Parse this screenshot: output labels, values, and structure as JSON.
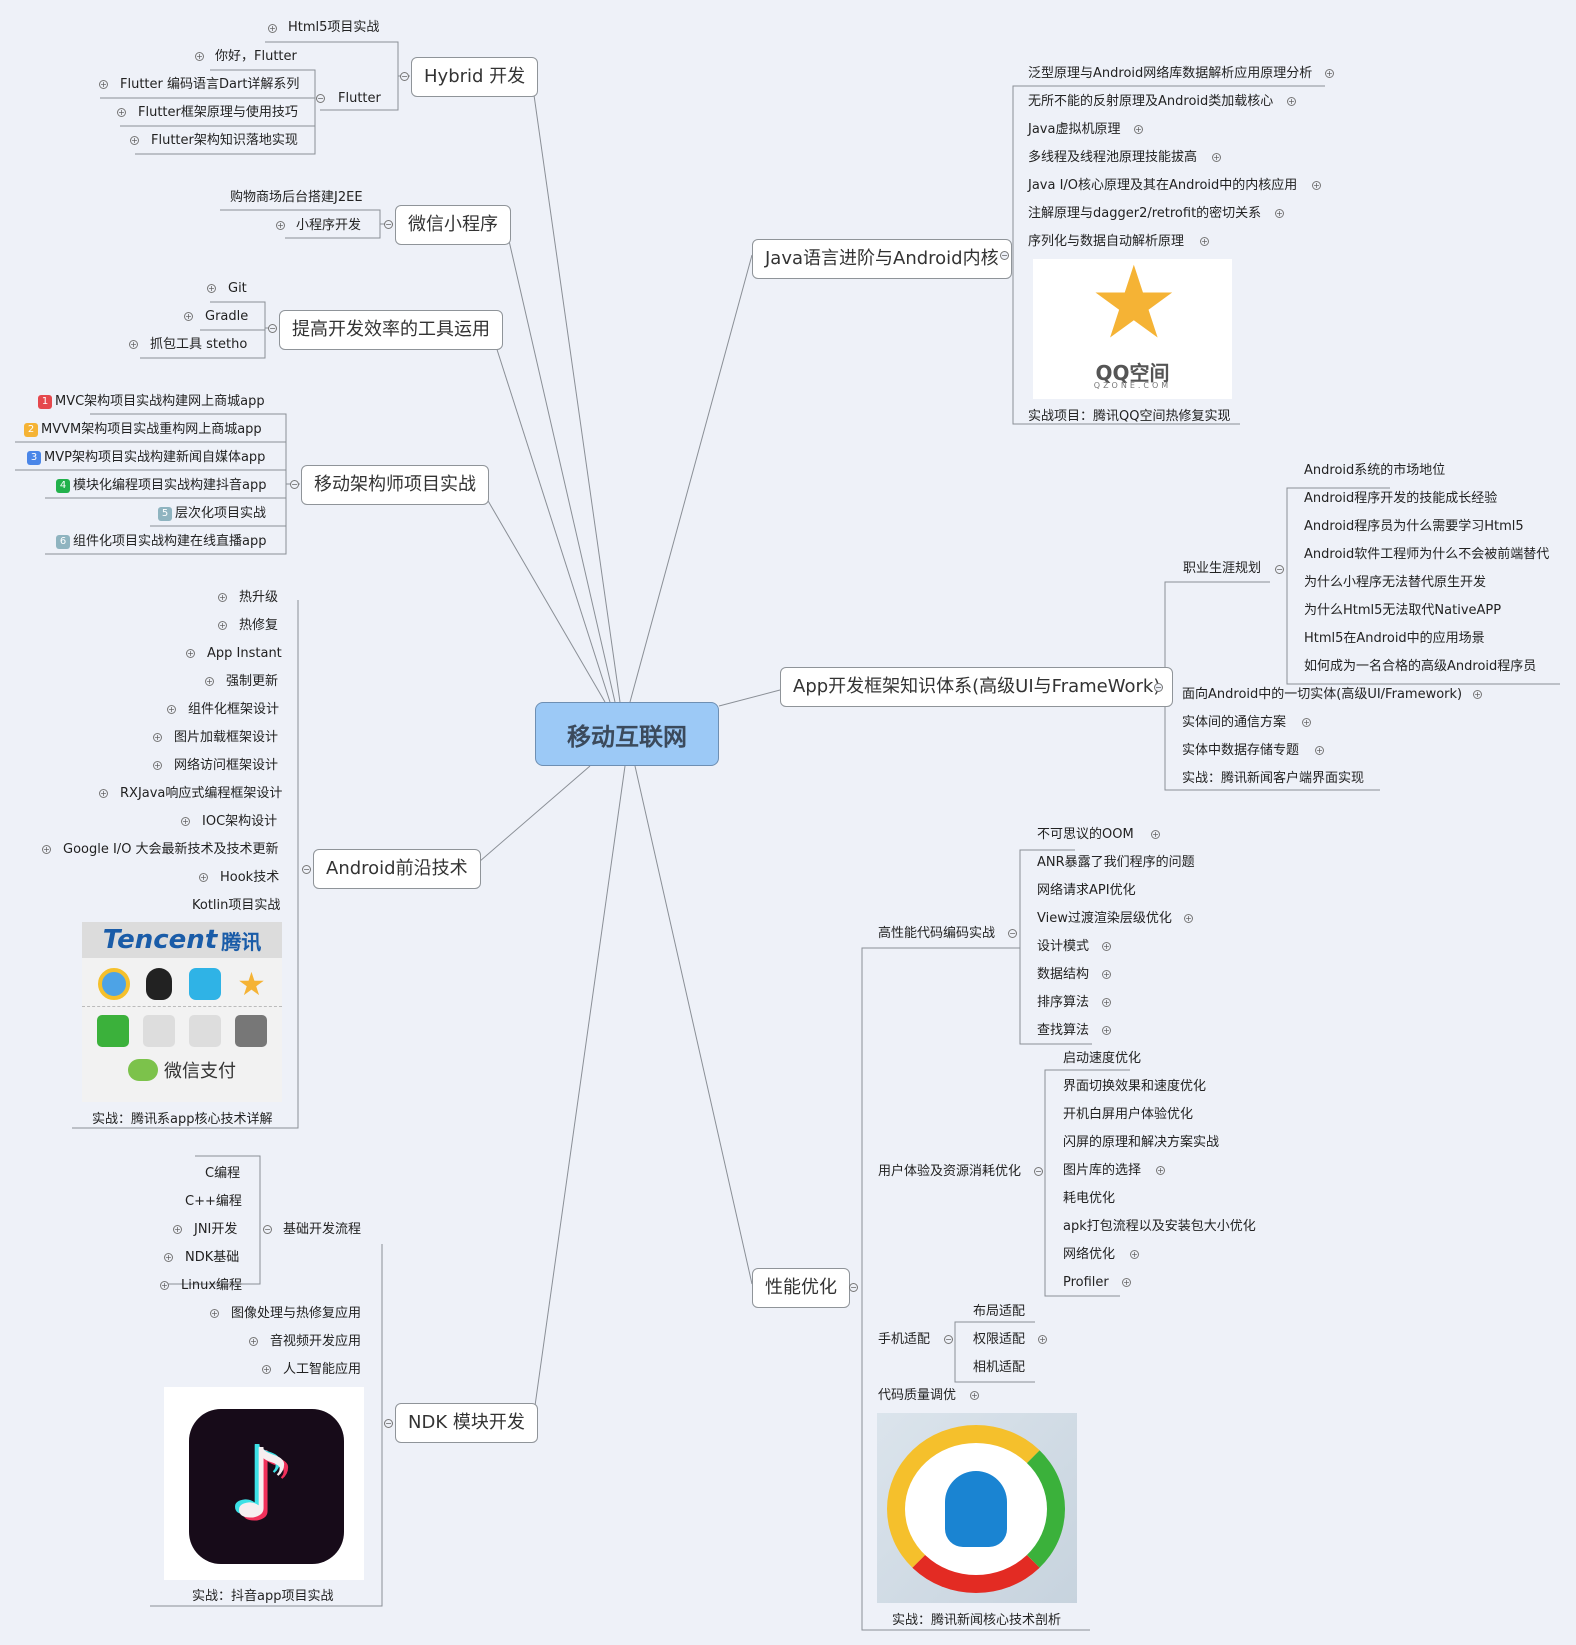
{
  "center": "移动互联网",
  "colors": {
    "center_fill": "#9cc9f6",
    "background": "#eef1f8",
    "line": "#8a8f96"
  },
  "hybrid": {
    "title": "Hybrid 开发",
    "html5": "Html5项目实战",
    "flutter": "Flutter",
    "flutter_items": [
      "你好，Flutter",
      "Flutter 编码语言Dart详解系列",
      "Flutter框架原理与使用技巧",
      "Flutter架构知识落地实现"
    ]
  },
  "wechat": {
    "title": "微信小程序",
    "items": [
      "购物商场后台搭建J2EE",
      "小程序开发"
    ]
  },
  "tools": {
    "title": "提高开发效率的工具运用",
    "items": [
      "Git",
      "Gradle",
      "抓包工具 stetho"
    ]
  },
  "arch": {
    "title": "移动架构师项目实战",
    "items": [
      {
        "n": "1",
        "color": "#e5484d",
        "label": "MVC架构项目实战构建网上商城app"
      },
      {
        "n": "2",
        "color": "#f5b335",
        "label": "MVVM架构项目实战重构网上商城app"
      },
      {
        "n": "3",
        "color": "#4a86e8",
        "label": "MVP架构项目实战构建新闻自媒体app"
      },
      {
        "n": "4",
        "color": "#22b14c",
        "label": "模块化编程项目实战构建抖音app"
      },
      {
        "n": "5",
        "color": "#8fb4c0",
        "label": "层次化项目实战"
      },
      {
        "n": "6",
        "color": "#8fb4c0",
        "label": "组件化项目实战构建在线直播app"
      }
    ]
  },
  "frontier": {
    "title": "Android前沿技术",
    "items": [
      "热升级",
      "热修复",
      "App Instant",
      "强制更新",
      "组件化框架设计",
      "图片加载框架设计",
      "网络访问框架设计",
      "RXJava响应式编程框架设计",
      "IOC架构设计",
      "Google I/O 大会最新技术及技术更新",
      "Hook技术",
      "Kotlin项目实战"
    ],
    "image_brand": "Tencent",
    "image_brand_cn": "腾讯",
    "image_pay": "微信支付",
    "caption": "实战：腾讯系app核心技术详解"
  },
  "ndk": {
    "title": "NDK 模块开发",
    "basic": "基础开发流程",
    "basic_items": [
      "C编程",
      "C++编程",
      "JNI开发",
      "NDK基础",
      "Linux编程"
    ],
    "items": [
      "图像处理与热修复应用",
      "音视频开发应用",
      "人工智能应用"
    ],
    "caption": "实战：抖音app项目实战"
  },
  "java": {
    "title": "Java语言进阶与Android内核",
    "items": [
      "泛型原理与Android网络库数据解析应用原理分析",
      "无所不能的反射原理及Android类加载核心",
      "Java虚拟机原理",
      "多线程及线程池原理技能拔高",
      "Java I/O核心原理及其在Android中的内核应用",
      "注解原理与dagger2/retrofit的密切关系",
      "序列化与数据自动解析原理"
    ],
    "logo_text": "QQ空间",
    "logo_sub": "QZONE.COM",
    "caption": "实战项目：腾讯QQ空间热修复实现"
  },
  "framework": {
    "title": "App开发框架知识体系(高级UI与FrameWork)",
    "career": "职业生涯规划",
    "career_items": [
      "Android系统的市场地位",
      "Android程序开发的技能成长经验",
      "Android程序员为什么需要学习Html5",
      "Android软件工程师为什么不会被前端替代",
      "为什么小程序无法替代原生开发",
      "为什么Html5无法取代NativeAPP",
      "Html5在Android中的应用场景",
      "如何成为一名合格的高级Android程序员"
    ],
    "items": [
      "面向Android中的一切实体(高级UI/Framework)",
      "实体间的通信方案",
      "实体中数据存储专题",
      "实战：腾讯新闻客户端界面实现"
    ]
  },
  "perf": {
    "title": "性能优化",
    "code": "高性能代码编码实战",
    "code_items": [
      "不可思议的OOM",
      "ANR暴露了我们程序的问题",
      "网络请求API优化",
      "View过渡渲染层级优化",
      "设计模式",
      "数据结构",
      "排序算法",
      "查找算法"
    ],
    "ux": "用户体验及资源消耗优化",
    "ux_items": [
      "启动速度优化",
      "界面切换效果和速度优化",
      "开机白屏用户体验优化",
      "闪屏的原理和解决方案实战",
      "图片库的选择",
      "耗电优化",
      "apk打包流程以及安装包大小优化",
      "网络优化",
      "Profiler"
    ],
    "phone": "手机适配",
    "phone_items": [
      "布局适配",
      "权限适配",
      "相机适配"
    ],
    "quality": "代码质量调优",
    "caption": "实战：腾讯新闻核心技术剖析"
  }
}
